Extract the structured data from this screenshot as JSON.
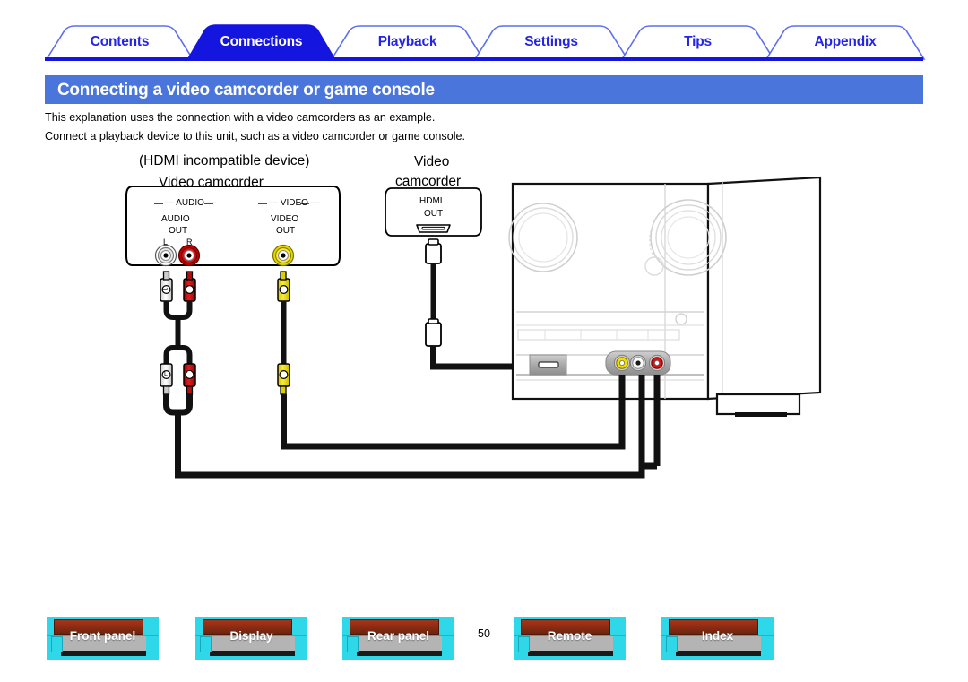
{
  "nav": {
    "tabs": [
      {
        "label": "Contents",
        "active": false
      },
      {
        "label": "Connections",
        "active": true
      },
      {
        "label": "Playback",
        "active": false
      },
      {
        "label": "Settings",
        "active": false
      },
      {
        "label": "Tips",
        "active": false
      },
      {
        "label": "Appendix",
        "active": false
      }
    ],
    "active_color": "#1515e0",
    "inactive_text_color": "#2424e8",
    "border_color": "#5b6ef0"
  },
  "header": {
    "title": "Connecting a video camcorder or game console",
    "banner_color": "#4a76dc"
  },
  "body": {
    "lines": [
      "This explanation uses the connection with a video camcorders as an example.",
      "Connect a playback device to this unit, such as a video camcorder or game console."
    ]
  },
  "diagram": {
    "analog_device": {
      "caption_top": "(HDMI incompatible device)",
      "caption_main": "Video camcorder",
      "audio_group_label": "— AUDIO —",
      "video_group_label": "— VIDEO —",
      "audio_out_line1": "AUDIO",
      "audio_out_line2": "OUT",
      "video_out_line1": "VIDEO",
      "video_out_line2": "OUT",
      "jack_left_label": "L",
      "jack_right_label": "R"
    },
    "hdmi_device": {
      "caption_line1": "Video",
      "caption_line2": "camcorder",
      "port_line1": "HDMI",
      "port_line2": "OUT"
    },
    "cable_plug_left_label": "L",
    "cable_plug_right_label": "R",
    "colors": {
      "video_yellow": "#f2e200",
      "audio_red": "#c00000",
      "audio_white": "#f2f2f2",
      "cable_black": "#111111",
      "panel_grey": "#a9a9a9"
    }
  },
  "footer": {
    "buttons": [
      {
        "label": "Front panel"
      },
      {
        "label": "Display"
      },
      {
        "label": "Rear panel"
      },
      {
        "label": "Remote"
      },
      {
        "label": "Index"
      }
    ],
    "page_number": "50",
    "button_color": "#2ed8e8"
  }
}
